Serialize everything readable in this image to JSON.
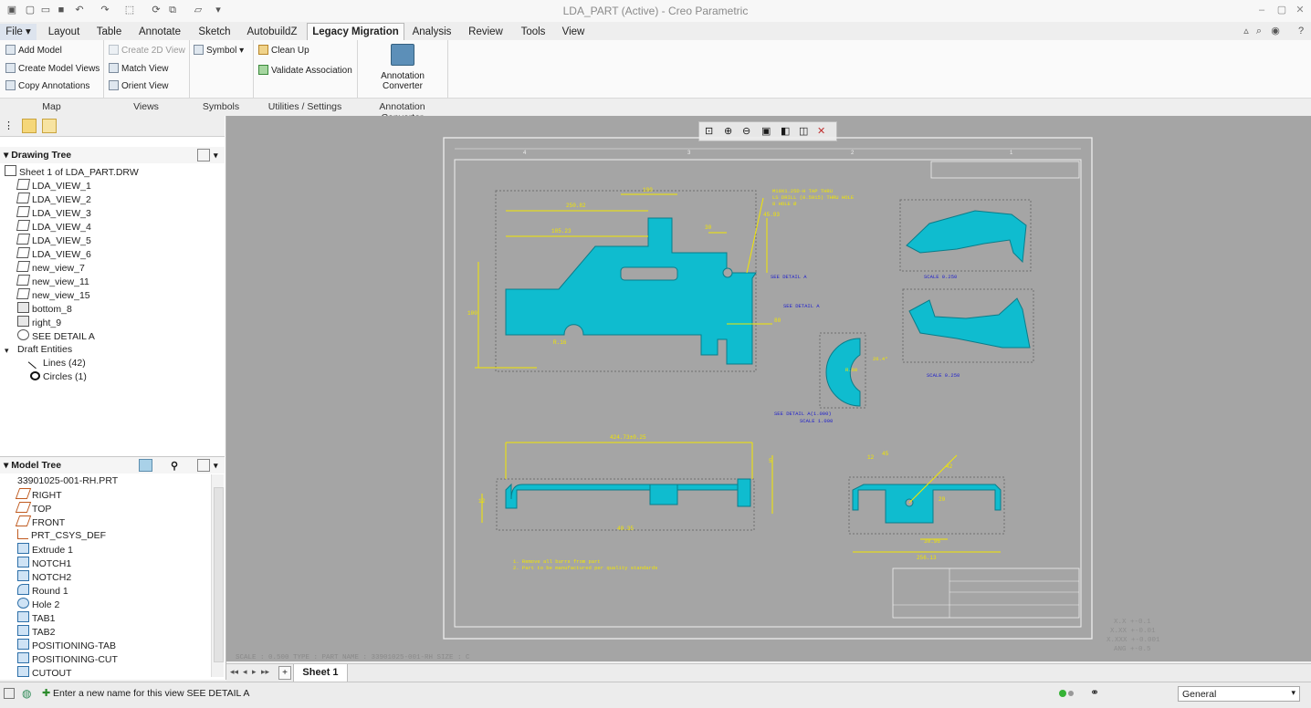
{
  "app": {
    "title": "LDA_PART (Active) - Creo Parametric"
  },
  "menu": {
    "file": "File ▾"
  },
  "tabs": [
    "Layout",
    "Table",
    "Annotate",
    "Sketch",
    "AutobuildZ",
    "Legacy Migration",
    "Analysis",
    "Review",
    "Tools",
    "View"
  ],
  "active_tab": "Legacy Migration",
  "ribbon": {
    "map": {
      "add_model": "Add Model",
      "create_model_views": "Create Model Views",
      "copy_annotations": "Copy Annotations",
      "label": "Map"
    },
    "views": {
      "create_2d_view": "Create 2D View",
      "match_view": "Match View",
      "orient_view": "Orient View",
      "label": "Views"
    },
    "symbols": {
      "symbol": "Symbol",
      "label": "Symbols"
    },
    "utilities": {
      "clean_up": "Clean Up",
      "validate_association": "Validate Association",
      "label": "Utilities / Settings"
    },
    "converter": {
      "line1": "Annotation",
      "line2": "Converter",
      "label": "Annotation Converter"
    }
  },
  "drawing_tree": {
    "title": "Drawing Tree",
    "items": [
      {
        "label": "Sheet 1 of LDA_PART.DRW",
        "icon": "sheet-icon",
        "indent": 0
      },
      {
        "label": "LDA_VIEW_1",
        "icon": "view-icon",
        "indent": 1
      },
      {
        "label": "LDA_VIEW_2",
        "icon": "view-icon",
        "indent": 1
      },
      {
        "label": "LDA_VIEW_3",
        "icon": "view-icon",
        "indent": 1
      },
      {
        "label": "LDA_VIEW_4",
        "icon": "view-icon",
        "indent": 1
      },
      {
        "label": "LDA_VIEW_5",
        "icon": "view-icon",
        "indent": 1
      },
      {
        "label": "LDA_VIEW_6",
        "icon": "view-icon",
        "indent": 1
      },
      {
        "label": "new_view_7",
        "icon": "view-icon",
        "indent": 1
      },
      {
        "label": "new_view_11",
        "icon": "view-icon",
        "indent": 1
      },
      {
        "label": "new_view_15",
        "icon": "view-icon",
        "indent": 1
      },
      {
        "label": "bottom_8",
        "icon": "projection-view-icon",
        "indent": 1
      },
      {
        "label": "right_9",
        "icon": "projection-view-icon",
        "indent": 1
      },
      {
        "label": "SEE DETAIL  A",
        "icon": "detail-view-icon",
        "indent": 1
      },
      {
        "label": "Draft Entities",
        "icon": "expand-icon",
        "indent": 0
      },
      {
        "label": "Lines (42)",
        "icon": "line-icon",
        "indent": 2
      },
      {
        "label": "Circles (1)",
        "icon": "circle-icon",
        "indent": 2
      }
    ]
  },
  "model_tree": {
    "title": "Model Tree",
    "items": [
      {
        "label": "33901025-001-RH.PRT",
        "icon": "part-icon"
      },
      {
        "label": "RIGHT",
        "icon": "datum-plane-icon"
      },
      {
        "label": "TOP",
        "icon": "datum-plane-icon"
      },
      {
        "label": "FRONT",
        "icon": "datum-plane-icon"
      },
      {
        "label": "PRT_CSYS_DEF",
        "icon": "csys-icon"
      },
      {
        "label": "Extrude 1",
        "icon": "extrude-icon"
      },
      {
        "label": "NOTCH1",
        "icon": "extrude-icon"
      },
      {
        "label": "NOTCH2",
        "icon": "extrude-icon"
      },
      {
        "label": "Round 1",
        "icon": "round-icon"
      },
      {
        "label": "Hole 2",
        "icon": "hole-icon"
      },
      {
        "label": "TAB1",
        "icon": "extrude-icon"
      },
      {
        "label": "TAB2",
        "icon": "extrude-icon"
      },
      {
        "label": "POSITIONING-TAB",
        "icon": "extrude-icon"
      },
      {
        "label": "POSITIONING-CUT",
        "icon": "extrude-icon"
      },
      {
        "label": "CUTOUT",
        "icon": "extrude-icon"
      }
    ]
  },
  "canvas": {
    "info_line": "SCALE : 0.500    TYPE : PART    NAME : 33901025-001-RH    SIZE : C",
    "tolerances": [
      "X.X  +-0.1",
      "X.XX  +-0.01",
      "X.XXX  +-0.001",
      "ANG  +-0.5"
    ],
    "notes": [
      "1. Remove all burrs from part",
      "2. Part to be manufactured per quality standards"
    ],
    "see_detail_callouts": [
      "SEE DETAIL  A",
      "SEE DETAIL  A"
    ],
    "detail_label": [
      "SEE DETAIL  A(1.000)",
      "SCALE  1.000"
    ],
    "scale_labels": [
      "SCALE  0.250",
      "SCALE  0.250"
    ],
    "hole_note": [
      "M10X1.25D-H TAP THRU",
      "LS DRILL (0.5915) THRU HOLE",
      "8 HOLE Ø"
    ],
    "dims": {
      "top_250": "250.82",
      "top_100": "100",
      "top_185": "185.23",
      "left_100": "100",
      "right_45": "45.93",
      "right_30": "30",
      "right_80": "80",
      "diag_r": "R.16",
      "b_30": "30",
      "bottom_long": "424.73±0.25",
      "bottom_5": "5",
      "bottom_12": "12",
      "bottom_40": "40.35",
      "r_12": "12",
      "r_45": "45",
      "r_42": "42",
      "r_20": "20",
      "r_30": "30.96",
      "r_256": "256.13",
      "det_r": "R.60",
      "det_a": "26.4°"
    },
    "colors": {
      "part": "#0fbccf",
      "dim": "#f2e600",
      "note_blue": "#2222cc",
      "background": "#a5a5a5"
    }
  },
  "sheet": {
    "tab": "Sheet 1",
    "add": "+"
  },
  "status": {
    "message": "Enter a new name for this view  SEE DETAIL  A",
    "filter": "General"
  }
}
